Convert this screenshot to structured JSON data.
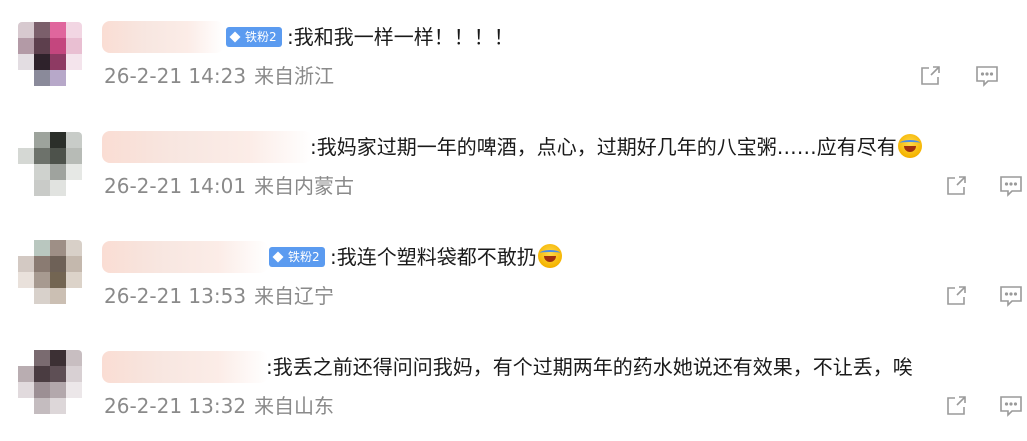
{
  "comments": [
    {
      "badge": "铁粉2",
      "text": ":我和我一样一样！！！！",
      "date": "26-2-21 14:23",
      "location": "来自浙江"
    },
    {
      "badge": "",
      "text": ":我妈家过期一年的啤酒，点心，过期好几年的八宝粥……应有尽有",
      "date": "26-2-21 14:01",
      "location": "来自内蒙古"
    },
    {
      "badge": "铁粉2",
      "text": ":我连个塑料袋都不敢扔",
      "date": "26-2-21 13:53",
      "location": "来自辽宁"
    },
    {
      "badge": "",
      "text": ":我丢之前还得问问我妈，有个过期两年的药水她说还有效果，不让丢，唉",
      "date": "26-2-21 13:32",
      "location": "来自山东"
    }
  ],
  "icons": {
    "share": "share-icon",
    "comment": "comment-icon",
    "emoji": "laughing-crying-emoji-icon",
    "badge": "diamond-icon"
  },
  "colors": {
    "badge_bg": "#5b9bf0",
    "meta_text": "#8a8a8a",
    "body_text": "#1a1a1a",
    "icon": "#9a9a9a"
  }
}
